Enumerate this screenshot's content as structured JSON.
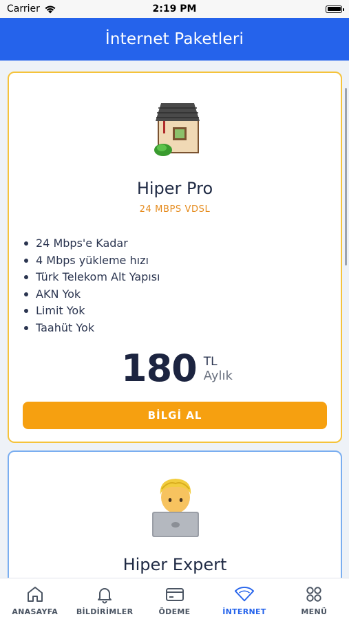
{
  "status_bar": {
    "carrier": "Carrier",
    "time": "2:19 PM"
  },
  "header": {
    "title": "İnternet Paketleri"
  },
  "plans": [
    {
      "icon": "house-emoji",
      "name": "Hiper Pro",
      "subtitle": "24 MBPS VDSL",
      "features": [
        "24 Mbps'e Kadar",
        "4 Mbps yükleme hızı",
        "Türk Telekom Alt Yapısı",
        "AKN Yok",
        "Limit Yok",
        "Taahüt Yok"
      ],
      "price": "180",
      "currency": "TL",
      "period": "Aylık",
      "cta_label": "BİLGİ AL",
      "border_color": "#f5c33b"
    },
    {
      "icon": "person-laptop-emoji",
      "name": "Hiper Expert",
      "border_color": "#7aaef0"
    }
  ],
  "tabs": [
    {
      "label": "ANASAYFA",
      "icon": "home-icon",
      "active": false
    },
    {
      "label": "BİLDİRİMLER",
      "icon": "bell-icon",
      "active": false
    },
    {
      "label": "ÖDEME",
      "icon": "credit-card-icon",
      "active": false
    },
    {
      "label": "İNTERNET",
      "icon": "wifi-icon",
      "active": true
    },
    {
      "label": "MENÜ",
      "icon": "grid-icon",
      "active": false
    }
  ],
  "colors": {
    "primary": "#2563eb",
    "accent": "#f6a010"
  }
}
